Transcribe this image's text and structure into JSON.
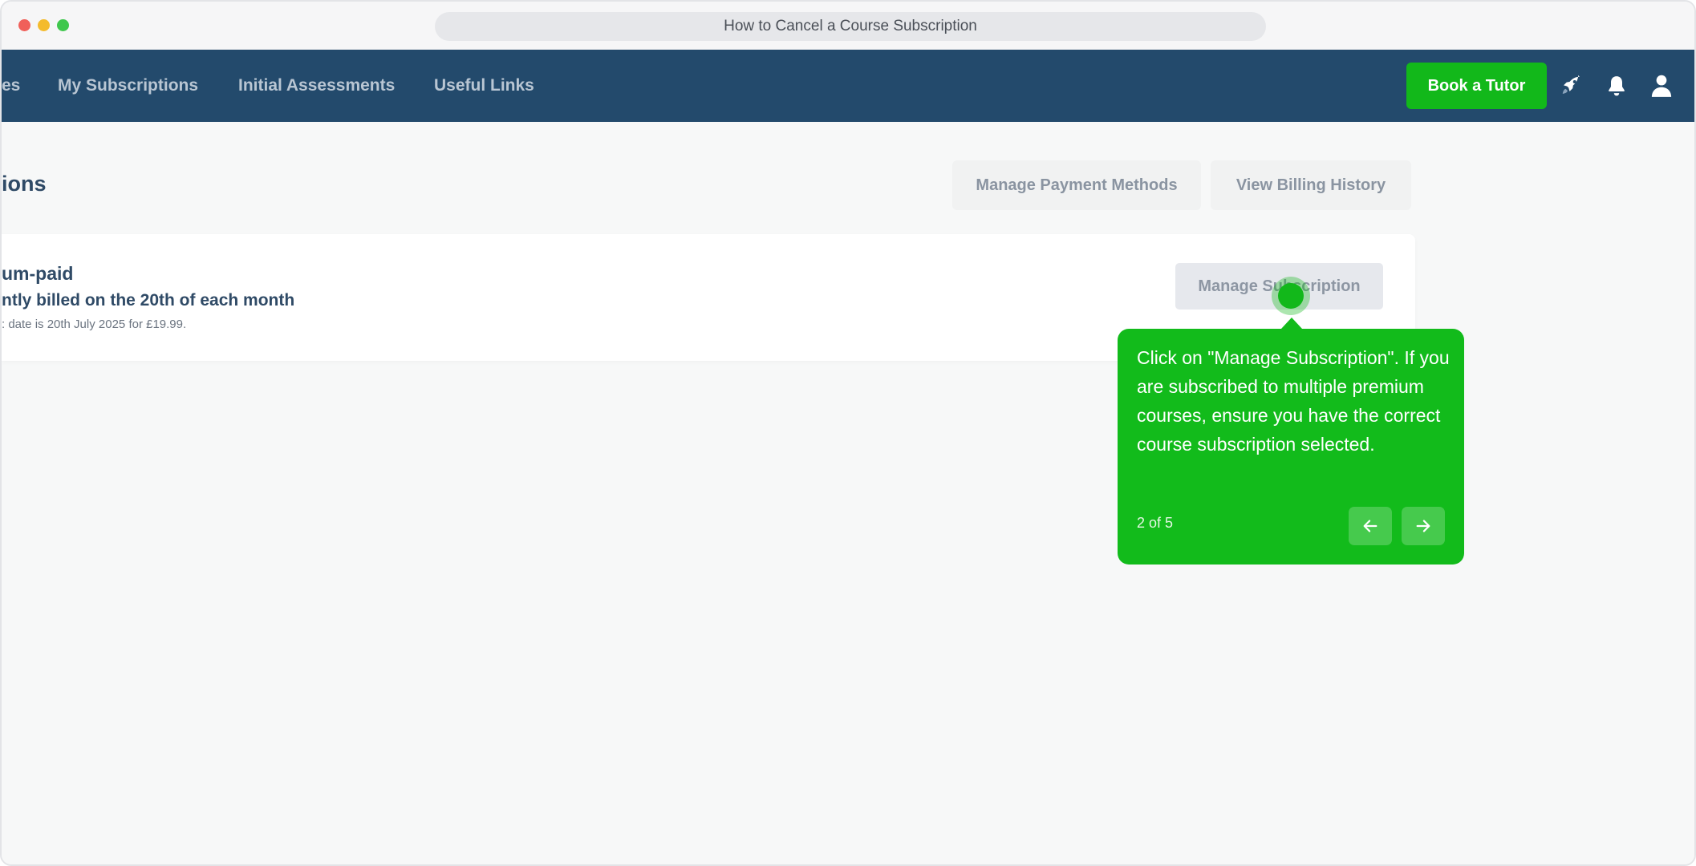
{
  "window": {
    "title": "How to Cancel a Course Subscription"
  },
  "nav": {
    "partial_item": "es",
    "items": [
      "My Subscriptions",
      "Initial Assessments",
      "Useful Links"
    ],
    "book_button": "Book a Tutor",
    "icons": [
      "rocket-icon",
      "bell-icon",
      "user-icon"
    ]
  },
  "page": {
    "title_partial": "ions",
    "manage_payment_label": "Manage Payment Methods",
    "view_billing_label": "View Billing History"
  },
  "subscription": {
    "name_partial": "um-paid",
    "billing_partial": "ntly billed on the 20th of each month",
    "next_partial": ": date is 20th July 2025 for £19.99.",
    "manage_label": "Manage Subscription"
  },
  "tooltip": {
    "text": "Click on \"Manage Subscription\". If you are subscribed to multiple premium courses, ensure you have the correct course subscription selected.",
    "step": "2 of 5",
    "accent": "#12bb1b"
  },
  "colors": {
    "nav_bg": "#234a6c",
    "primary_green": "#12b81a"
  }
}
